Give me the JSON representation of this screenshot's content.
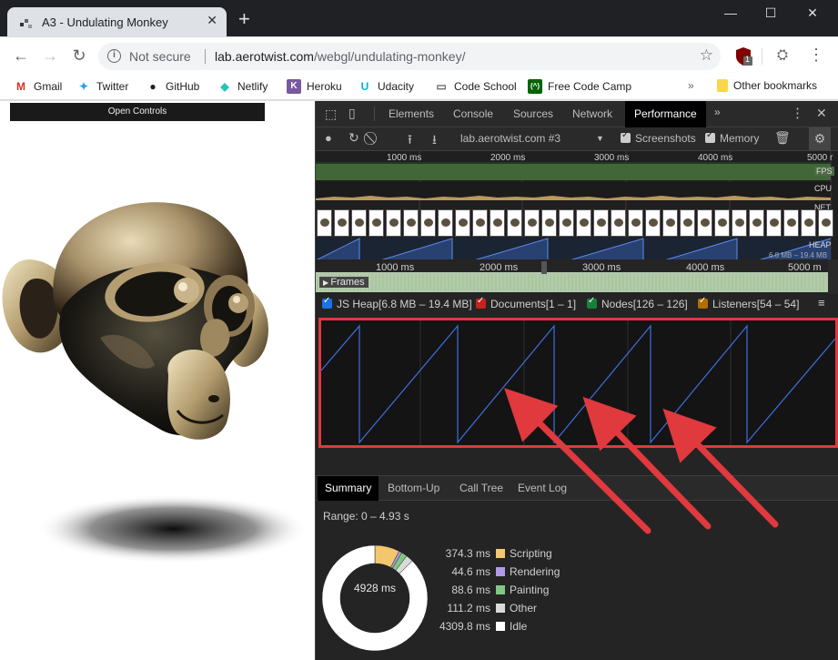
{
  "browser": {
    "tab_title": "A3 - Undulating Monkey",
    "new_tab": "+",
    "window_controls": {
      "minimize": "—",
      "maximize": "☐",
      "close": "✕"
    }
  },
  "toolbar": {
    "security_text": "Not secure",
    "url_host": "lab.aerotwist.com",
    "url_path": "/webgl/undulating-monkey/",
    "extension_badge": "1"
  },
  "bookmarks": {
    "items": [
      {
        "label": "Gmail",
        "icon": "gmail-icon",
        "glyph": "M",
        "color": "#d93025"
      },
      {
        "label": "Twitter",
        "icon": "twitter-icon",
        "glyph": "✦",
        "color": "#1da1f2"
      },
      {
        "label": "GitHub",
        "icon": "github-icon",
        "glyph": "●",
        "color": "#202124"
      },
      {
        "label": "Netlify",
        "icon": "netlify-icon",
        "glyph": "◆",
        "color": "#20c6b7"
      },
      {
        "label": "Heroku",
        "icon": "heroku-icon",
        "glyph": "K",
        "color": "#79589f"
      },
      {
        "label": "Udacity",
        "icon": "udacity-icon",
        "glyph": "U",
        "color": "#02b3e4"
      },
      {
        "label": "Code School",
        "icon": "page-icon",
        "glyph": "▭",
        "color": "#5f6368"
      },
      {
        "label": "Free Code Camp",
        "icon": "freecodecamp-icon",
        "glyph": "(^)",
        "color": "#006400"
      }
    ],
    "overflow": "»",
    "other": "Other bookmarks"
  },
  "page": {
    "open_controls": "Open Controls"
  },
  "devtools": {
    "tabs": [
      "Elements",
      "Console",
      "Sources",
      "Network",
      "Performance"
    ],
    "active_tab": "Performance",
    "more_tabs": "»",
    "recording_select": "lab.aerotwist.com #3",
    "screenshots_label": "Screenshots",
    "memory_label": "Memory",
    "overview_ticks": [
      "1000 ms",
      "2000 ms",
      "3000 ms",
      "4000 ms",
      "5000 r"
    ],
    "track_labels": {
      "fps": "FPS",
      "cpu": "CPU",
      "net": "NET",
      "heap": "HEAP",
      "heap_range": "6.8 MB – 19.4 MB"
    },
    "main_ticks": [
      "1000 ms",
      "2000 ms",
      "3000 ms",
      "4000 ms",
      "5000 m"
    ],
    "frames_label": "Frames",
    "counters": [
      {
        "label": "JS Heap[6.8 MB – 19.4 MB]",
        "color": "#1a73e8"
      },
      {
        "label": "Documents[1 – 1]",
        "color": "#c5221f"
      },
      {
        "label": "Nodes[126 – 126]",
        "color": "#188038"
      },
      {
        "label": "Listeners[54 – 54]",
        "color": "#b26c00"
      }
    ],
    "bottom_tabs": [
      "Summary",
      "Bottom-Up",
      "Call Tree",
      "Event Log"
    ],
    "active_bottom_tab": "Summary",
    "summary": {
      "range": "Range: 0 – 4.93 s",
      "total": "4928 ms",
      "rows": [
        {
          "value": "374.3 ms",
          "label": "Scripting",
          "color": "#f2c76d"
        },
        {
          "value": "44.6 ms",
          "label": "Rendering",
          "color": "#b09ae8"
        },
        {
          "value": "88.6 ms",
          "label": "Painting",
          "color": "#81c784"
        },
        {
          "value": "111.2 ms",
          "label": "Other",
          "color": "#dadada"
        },
        {
          "value": "4309.8 ms",
          "label": "Idle",
          "color": "#ffffff"
        }
      ]
    }
  }
}
